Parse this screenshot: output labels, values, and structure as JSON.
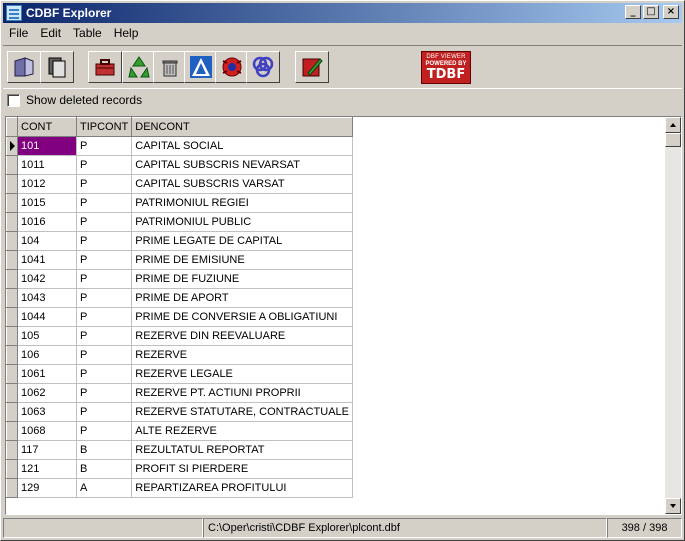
{
  "window": {
    "title": "CDBF Explorer"
  },
  "title_controls": {
    "minimize": "_",
    "maximize": "□",
    "close": "×"
  },
  "menu": [
    "File",
    "Edit",
    "Table",
    "Help"
  ],
  "toolbar": {
    "buttons": [
      "open-folder-icon",
      "copy-document-icon",
      "toolbox-icon",
      "recycle-icon",
      "trash-can-icon",
      "filter-triangle-icon",
      "bug-icon",
      "knot-icon",
      "edit-book-icon"
    ],
    "logo": {
      "line1": "DBF VIEWER",
      "line2": "POWERED BY",
      "line3": "TDBF"
    }
  },
  "options": {
    "show_deleted_label": "Show deleted records",
    "show_deleted_checked": false
  },
  "grid": {
    "columns": [
      "CONT",
      "TIPCONT",
      "DENCONT"
    ],
    "rows": [
      [
        "101",
        "P",
        "CAPITAL SOCIAL"
      ],
      [
        "1011",
        "P",
        "CAPITAL SUBSCRIS NEVARSAT"
      ],
      [
        "1012",
        "P",
        "CAPITAL SUBSCRIS VARSAT"
      ],
      [
        "1015",
        "P",
        "PATRIMONIUL REGIEI"
      ],
      [
        "1016",
        "P",
        "PATRIMONIUL PUBLIC"
      ],
      [
        "104",
        "P",
        "PRIME LEGATE DE CAPITAL"
      ],
      [
        "1041",
        "P",
        "PRIME DE EMISIUNE"
      ],
      [
        "1042",
        "P",
        "PRIME DE FUZIUNE"
      ],
      [
        "1043",
        "P",
        "PRIME DE APORT"
      ],
      [
        "1044",
        "P",
        "PRIME DE CONVERSIE A OBLIGATIUNI"
      ],
      [
        "105",
        "P",
        "REZERVE  DIN REEVALUARE"
      ],
      [
        "106",
        "P",
        "REZERVE"
      ],
      [
        "1061",
        "P",
        "REZERVE LEGALE"
      ],
      [
        "1062",
        "P",
        "REZERVE PT. ACTIUNI PROPRII"
      ],
      [
        "1063",
        "P",
        "REZERVE STATUTARE, CONTRACTUALE"
      ],
      [
        "1068",
        "P",
        "ALTE REZERVE"
      ],
      [
        "117",
        "B",
        "REZULTATUL REPORTAT"
      ],
      [
        "121",
        "B",
        "PROFIT SI PIERDERE"
      ],
      [
        "129",
        "A",
        "REPARTIZAREA PROFITULUI"
      ]
    ]
  },
  "status": {
    "left": "",
    "path": "C:\\Oper\\cristi\\CDBF Explorer\\plcont.dbf",
    "count": "398 / 398"
  },
  "colors": {
    "selection": "#800080",
    "titlebar_start": "#0a246a",
    "titlebar_end": "#a6caf0",
    "face": "#d4d0c8"
  }
}
